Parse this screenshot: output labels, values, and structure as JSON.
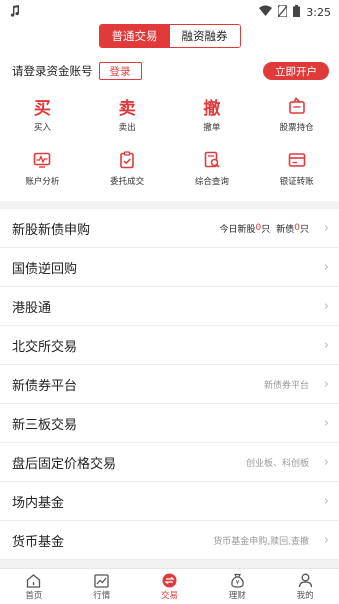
{
  "status_bar": {
    "time": "3:25",
    "left_icon": "music-note-icon"
  },
  "segment": {
    "tabs": [
      {
        "label": "普通交易",
        "active": true
      },
      {
        "label": "融资融券",
        "active": false
      }
    ]
  },
  "account": {
    "prompt": "请登录资金账号",
    "login_label": "登录",
    "open_label": "立即开户"
  },
  "actions": [
    {
      "label": "买入",
      "glyph": "买",
      "icon": "buy-icon"
    },
    {
      "label": "卖出",
      "glyph": "卖",
      "icon": "sell-icon"
    },
    {
      "label": "撤单",
      "glyph": "撤",
      "icon": "cancel-order-icon"
    },
    {
      "label": "股票持仓",
      "icon": "holdings-icon"
    },
    {
      "label": "账户分析",
      "icon": "account-analysis-icon"
    },
    {
      "label": "委托成交",
      "icon": "orders-icon"
    },
    {
      "label": "综合查询",
      "icon": "query-icon"
    },
    {
      "label": "银证转账",
      "icon": "transfer-icon"
    }
  ],
  "list": [
    {
      "title": "新股新债申购",
      "right": {
        "a": "今日新股",
        "a_num": "0",
        "a_unit": "只",
        "b": "新债",
        "b_num": "0",
        "b_unit": "只"
      }
    },
    {
      "title": "国债逆回购"
    },
    {
      "title": "港股通"
    },
    {
      "title": "北交所交易"
    },
    {
      "title": "新债券平台",
      "note": "新债券平台"
    },
    {
      "title": "新三板交易"
    },
    {
      "title": "盘后固定价格交易",
      "note": "创业板、科创板"
    },
    {
      "title": "场内基金"
    },
    {
      "title": "货币基金",
      "note": "货币基金申购,赎回,查撤"
    }
  ],
  "tabbar": [
    {
      "label": "首页",
      "icon": "home-icon",
      "active": false
    },
    {
      "label": "行情",
      "icon": "market-chart-icon",
      "active": false
    },
    {
      "label": "交易",
      "icon": "trade-icon",
      "active": true
    },
    {
      "label": "理财",
      "icon": "wealth-bag-icon",
      "active": false
    },
    {
      "label": "我的",
      "icon": "profile-icon",
      "active": false
    }
  ],
  "colors": {
    "accent": "#e03a3a"
  }
}
